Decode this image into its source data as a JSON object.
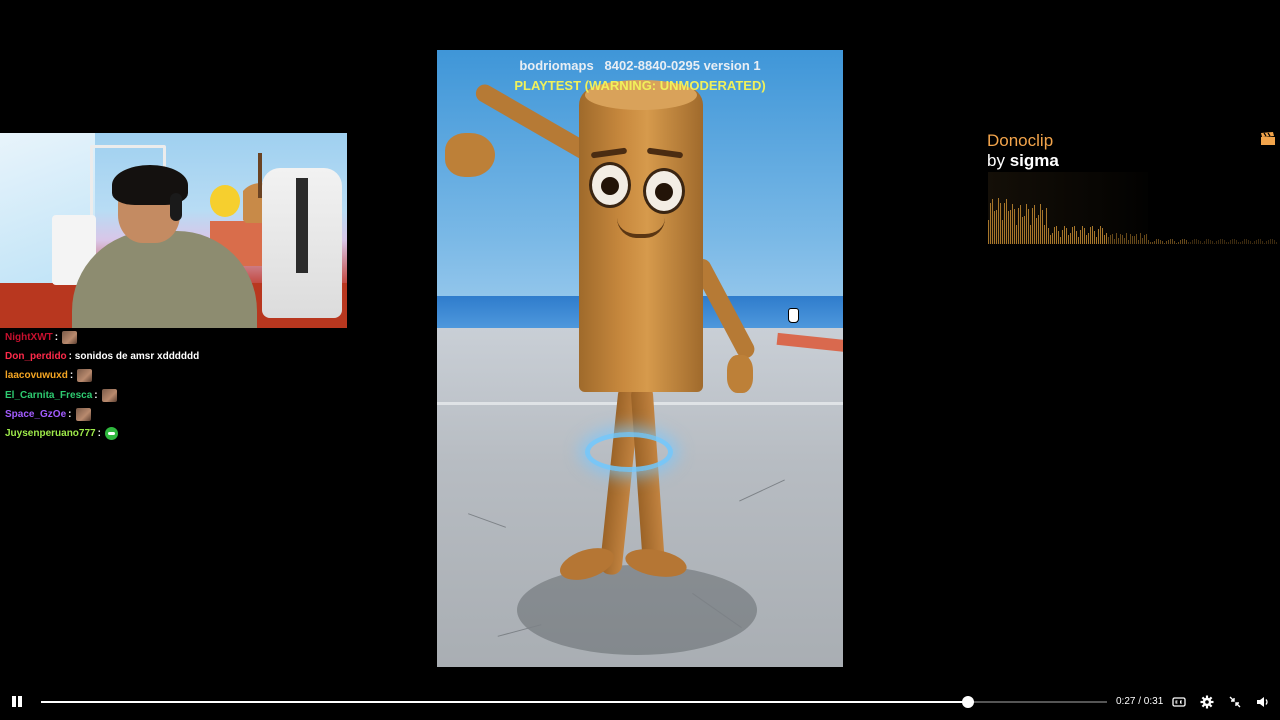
{
  "webcam": {
    "alt": "streamer webcam"
  },
  "chat": [
    {
      "user": "NightXWT",
      "color": "#c8102e",
      "message": "",
      "emote": "brown"
    },
    {
      "user": "Don_perdido",
      "color": "#ff2a4a",
      "message": "sonidos de amsr xdddddd",
      "emote": ""
    },
    {
      "user": "laacovuwuxd",
      "color": "#f5a623",
      "message": "",
      "emote": "brown"
    },
    {
      "user": "El_Carnita_Fresca",
      "color": "#2ecc71",
      "message": "",
      "emote": "brown"
    },
    {
      "user": "Space_GzOe",
      "color": "#a35cff",
      "message": "",
      "emote": "brown"
    },
    {
      "user": "Juysenperuano777",
      "color": "#9eea4a",
      "message": "",
      "emote": "green"
    }
  ],
  "video": {
    "map_name": "bodriomaps   8402-8840-0295 version 1",
    "playtest": "PLAYTEST (WARNING: UNMODERATED)"
  },
  "donoclip": {
    "title": "Donoclip",
    "by_prefix": "by ",
    "author": "sigma",
    "accent_color": "#f2a44b"
  },
  "player": {
    "current_time": "0:27",
    "duration": "0:31",
    "time_label": "0:27 / 0:31",
    "progress": 0.87
  }
}
